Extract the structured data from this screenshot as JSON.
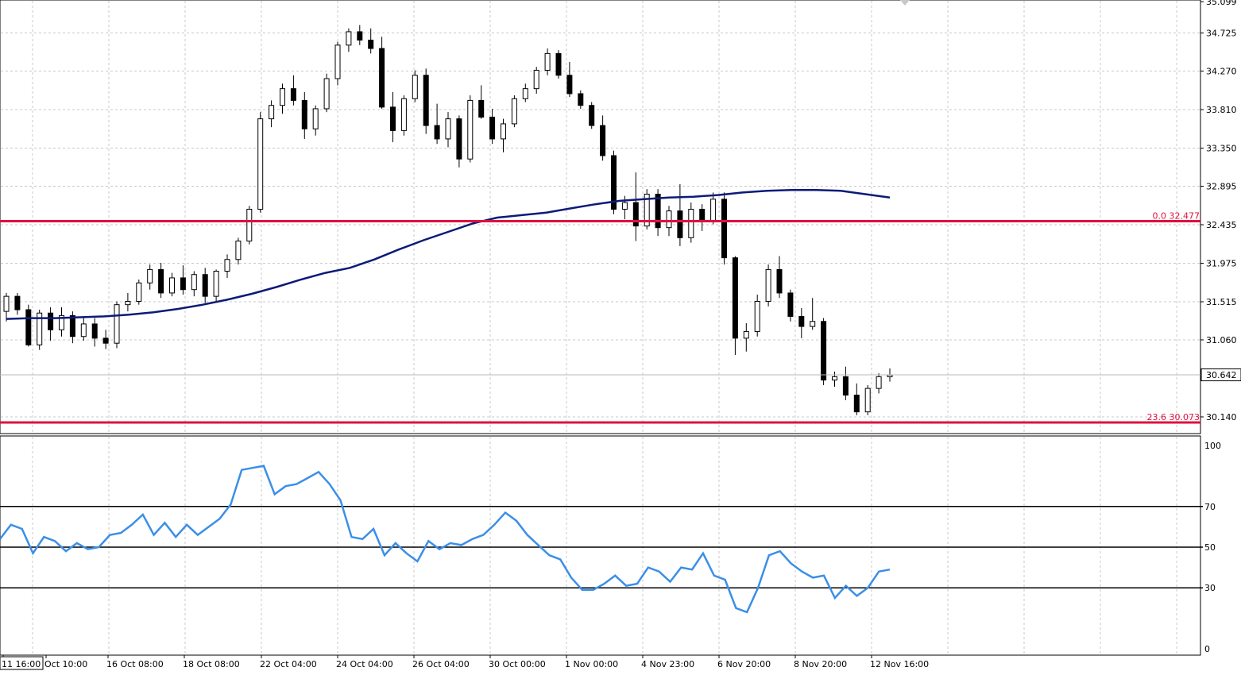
{
  "colors": {
    "background": "#ffffff",
    "grid": "#c8c8c8",
    "candle_up": "#ffffff",
    "candle_down": "#000000",
    "candle_outline": "#000000",
    "moving_average": "#0c1a78",
    "fib_line": "#e0103f",
    "rsi_line": "#3b8fe8",
    "rsi_level": "#000000",
    "price_tag_bg": "#ffffff"
  },
  "chart_data": [
    {
      "type": "candlestick",
      "panel": "price",
      "ylim": [
        29.95,
        35.1
      ],
      "y_ticks": [
        "35.099",
        "34.725",
        "34.270",
        "33.810",
        "33.350",
        "32.895",
        "32.435",
        "31.975",
        "31.515",
        "31.060",
        "30.140"
      ],
      "x_ticks": [
        "11 16:00",
        "Oct 10:00",
        "16 Oct 08:00",
        "18 Oct 08:00",
        "22 Oct 04:00",
        "24 Oct 04:00",
        "26 Oct 04:00",
        "30 Oct 00:00",
        "1 Nov 00:00",
        "4 Nov 23:00",
        "6 Nov 20:00",
        "8 Nov 20:00",
        "12 Nov 16:00"
      ],
      "current_price": "30.642",
      "fib_levels": [
        {
          "label": "0.0 32.477",
          "value": 32.477
        },
        {
          "label": "23.6 30.073",
          "value": 30.073
        }
      ],
      "series": [
        {
          "name": "",
          "style": "candles",
          "ohlc": [
            [
              31.4,
              31.62,
              31.28,
              31.58
            ],
            [
              31.58,
              31.62,
              31.36,
              31.42
            ],
            [
              31.42,
              31.48,
              30.98,
              31.0
            ],
            [
              31.0,
              31.42,
              30.94,
              31.38
            ],
            [
              31.38,
              31.45,
              31.05,
              31.18
            ],
            [
              31.18,
              31.45,
              31.1,
              31.35
            ],
            [
              31.35,
              31.4,
              31.02,
              31.1
            ],
            [
              31.1,
              31.32,
              31.05,
              31.25
            ],
            [
              31.25,
              31.32,
              30.98,
              31.08
            ],
            [
              31.08,
              31.18,
              30.95,
              31.02
            ],
            [
              31.02,
              31.52,
              30.96,
              31.48
            ],
            [
              31.48,
              31.62,
              31.4,
              31.52
            ],
            [
              31.52,
              31.78,
              31.48,
              31.74
            ],
            [
              31.74,
              31.96,
              31.66,
              31.9
            ],
            [
              31.9,
              31.98,
              31.56,
              31.62
            ],
            [
              31.62,
              31.86,
              31.58,
              31.8
            ],
            [
              31.8,
              31.95,
              31.6,
              31.66
            ],
            [
              31.66,
              31.88,
              31.58,
              31.84
            ],
            [
              31.84,
              31.92,
              31.5,
              31.58
            ],
            [
              31.58,
              31.9,
              31.52,
              31.88
            ],
            [
              31.88,
              32.08,
              31.8,
              32.02
            ],
            [
              32.02,
              32.28,
              31.96,
              32.24
            ],
            [
              32.24,
              32.66,
              32.2,
              32.62
            ],
            [
              32.62,
              33.78,
              32.58,
              33.7
            ],
            [
              33.7,
              33.92,
              33.6,
              33.86
            ],
            [
              33.86,
              34.12,
              33.76,
              34.06
            ],
            [
              34.06,
              34.22,
              33.86,
              33.92
            ],
            [
              33.92,
              34.02,
              33.46,
              33.58
            ],
            [
              33.58,
              33.86,
              33.5,
              33.82
            ],
            [
              33.82,
              34.24,
              33.78,
              34.18
            ],
            [
              34.18,
              34.62,
              34.1,
              34.58
            ],
            [
              34.58,
              34.78,
              34.5,
              34.74
            ],
            [
              34.74,
              34.82,
              34.58,
              34.64
            ],
            [
              34.64,
              34.78,
              34.48,
              34.54
            ],
            [
              34.54,
              34.68,
              33.82,
              33.84
            ],
            [
              33.84,
              34.02,
              33.42,
              33.56
            ],
            [
              33.56,
              33.98,
              33.5,
              33.94
            ],
            [
              33.94,
              34.28,
              33.9,
              34.22
            ],
            [
              34.22,
              34.3,
              33.52,
              33.62
            ],
            [
              33.62,
              33.88,
              33.4,
              33.46
            ],
            [
              33.46,
              33.78,
              33.36,
              33.7
            ],
            [
              33.7,
              33.74,
              33.12,
              33.22
            ],
            [
              33.22,
              33.98,
              33.18,
              33.92
            ],
            [
              33.92,
              34.1,
              33.7,
              33.72
            ],
            [
              33.72,
              33.82,
              33.4,
              33.46
            ],
            [
              33.46,
              33.7,
              33.3,
              33.64
            ],
            [
              33.64,
              33.98,
              33.6,
              33.94
            ],
            [
              33.94,
              34.12,
              33.9,
              34.06
            ],
            [
              34.06,
              34.32,
              34.0,
              34.28
            ],
            [
              34.28,
              34.54,
              34.22,
              34.48
            ],
            [
              34.48,
              34.52,
              34.18,
              34.22
            ],
            [
              34.22,
              34.38,
              33.96,
              34.0
            ],
            [
              34.0,
              34.04,
              33.82,
              33.86
            ],
            [
              33.86,
              33.9,
              33.58,
              33.62
            ],
            [
              33.62,
              33.74,
              33.2,
              33.26
            ],
            [
              33.26,
              33.32,
              32.56,
              32.62
            ],
            [
              32.62,
              32.78,
              32.5,
              32.7
            ],
            [
              32.7,
              33.06,
              32.24,
              32.42
            ],
            [
              32.42,
              32.86,
              32.38,
              32.8
            ],
            [
              32.8,
              32.86,
              32.3,
              32.4
            ],
            [
              32.4,
              32.66,
              32.3,
              32.6
            ],
            [
              32.6,
              32.92,
              32.18,
              32.28
            ],
            [
              32.28,
              32.7,
              32.22,
              32.62
            ],
            [
              32.62,
              32.68,
              32.36,
              32.48
            ],
            [
              32.48,
              32.82,
              32.44,
              32.74
            ],
            [
              32.74,
              32.82,
              31.96,
              32.04
            ],
            [
              32.04,
              32.06,
              30.88,
              31.08
            ],
            [
              31.08,
              31.26,
              30.92,
              31.16
            ],
            [
              31.16,
              31.6,
              31.1,
              31.52
            ],
            [
              31.52,
              31.96,
              31.46,
              31.9
            ],
            [
              31.9,
              32.06,
              31.56,
              31.62
            ],
            [
              31.62,
              31.66,
              31.28,
              31.34
            ],
            [
              31.34,
              31.44,
              31.08,
              31.22
            ],
            [
              31.22,
              31.56,
              31.18,
              31.28
            ],
            [
              31.28,
              31.32,
              30.52,
              30.58
            ],
            [
              30.58,
              30.68,
              30.5,
              30.62
            ],
            [
              30.62,
              30.74,
              30.34,
              30.4
            ],
            [
              30.4,
              30.54,
              30.16,
              30.2
            ],
            [
              30.2,
              30.52,
              30.16,
              30.48
            ],
            [
              30.48,
              30.66,
              30.42,
              30.62
            ],
            [
              30.62,
              30.72,
              30.56,
              30.64
            ]
          ]
        },
        {
          "name": "",
          "style": "line",
          "values": [
            31.31,
            31.32,
            31.32,
            31.33,
            31.34,
            31.36,
            31.39,
            31.43,
            31.48,
            31.54,
            31.61,
            31.69,
            31.78,
            31.86,
            31.92,
            32.02,
            32.14,
            32.25,
            32.35,
            32.45,
            32.52,
            32.55,
            32.58,
            32.63,
            32.68,
            32.72,
            32.74,
            32.76,
            32.77,
            32.79,
            32.82,
            32.84,
            32.85,
            32.85,
            32.84,
            32.8,
            32.76
          ]
        }
      ]
    },
    {
      "type": "line",
      "panel": "oscillator",
      "ylim": [
        0,
        100
      ],
      "y_ticks": [
        "100",
        "70",
        "50",
        "30",
        "0"
      ],
      "levels": [
        70,
        50,
        30
      ],
      "series": [
        {
          "name": "",
          "values": [
            54,
            61,
            59,
            47,
            55,
            53,
            48,
            52,
            49,
            50,
            56,
            57,
            61,
            66,
            56,
            62,
            55,
            61,
            56,
            60,
            64,
            71,
            88,
            89,
            90,
            76,
            80,
            81,
            84,
            87,
            81,
            73,
            55,
            54,
            59,
            46,
            52,
            47,
            43,
            53,
            49,
            52,
            51,
            54,
            56,
            61,
            67,
            63,
            56,
            51,
            46,
            44,
            35,
            29,
            29,
            32,
            36,
            31,
            32,
            40,
            38,
            33,
            40,
            39,
            47,
            36,
            34,
            20,
            18,
            30,
            46,
            48,
            42,
            38,
            35,
            36,
            25,
            31,
            26,
            30,
            38,
            39
          ]
        }
      ]
    }
  ]
}
